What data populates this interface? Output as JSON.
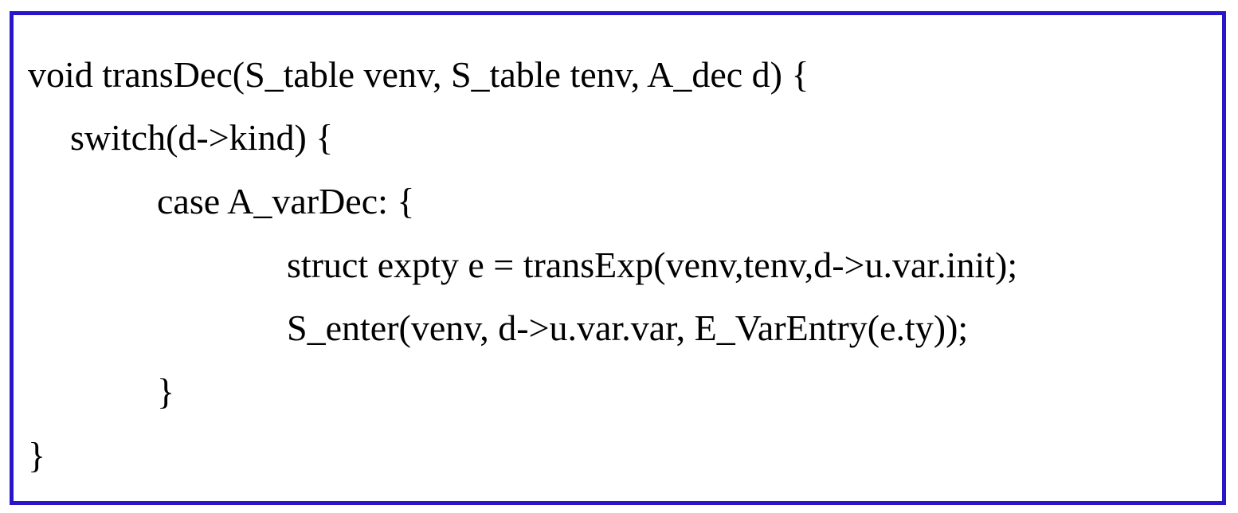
{
  "colors": {
    "frame_border": "#2a16c9",
    "text": "#000000",
    "background": "#ffffff"
  },
  "code": {
    "lines": [
      "void transDec(S_table venv, S_table tenv, A_dec d) {",
      "switch(d->kind) {",
      "case A_varDec: {",
      "struct expty e = transExp(venv,tenv,d->u.var.init);",
      "S_enter(venv, d->u.var.var, E_VarEntry(e.ty));",
      "}",
      "}"
    ]
  }
}
